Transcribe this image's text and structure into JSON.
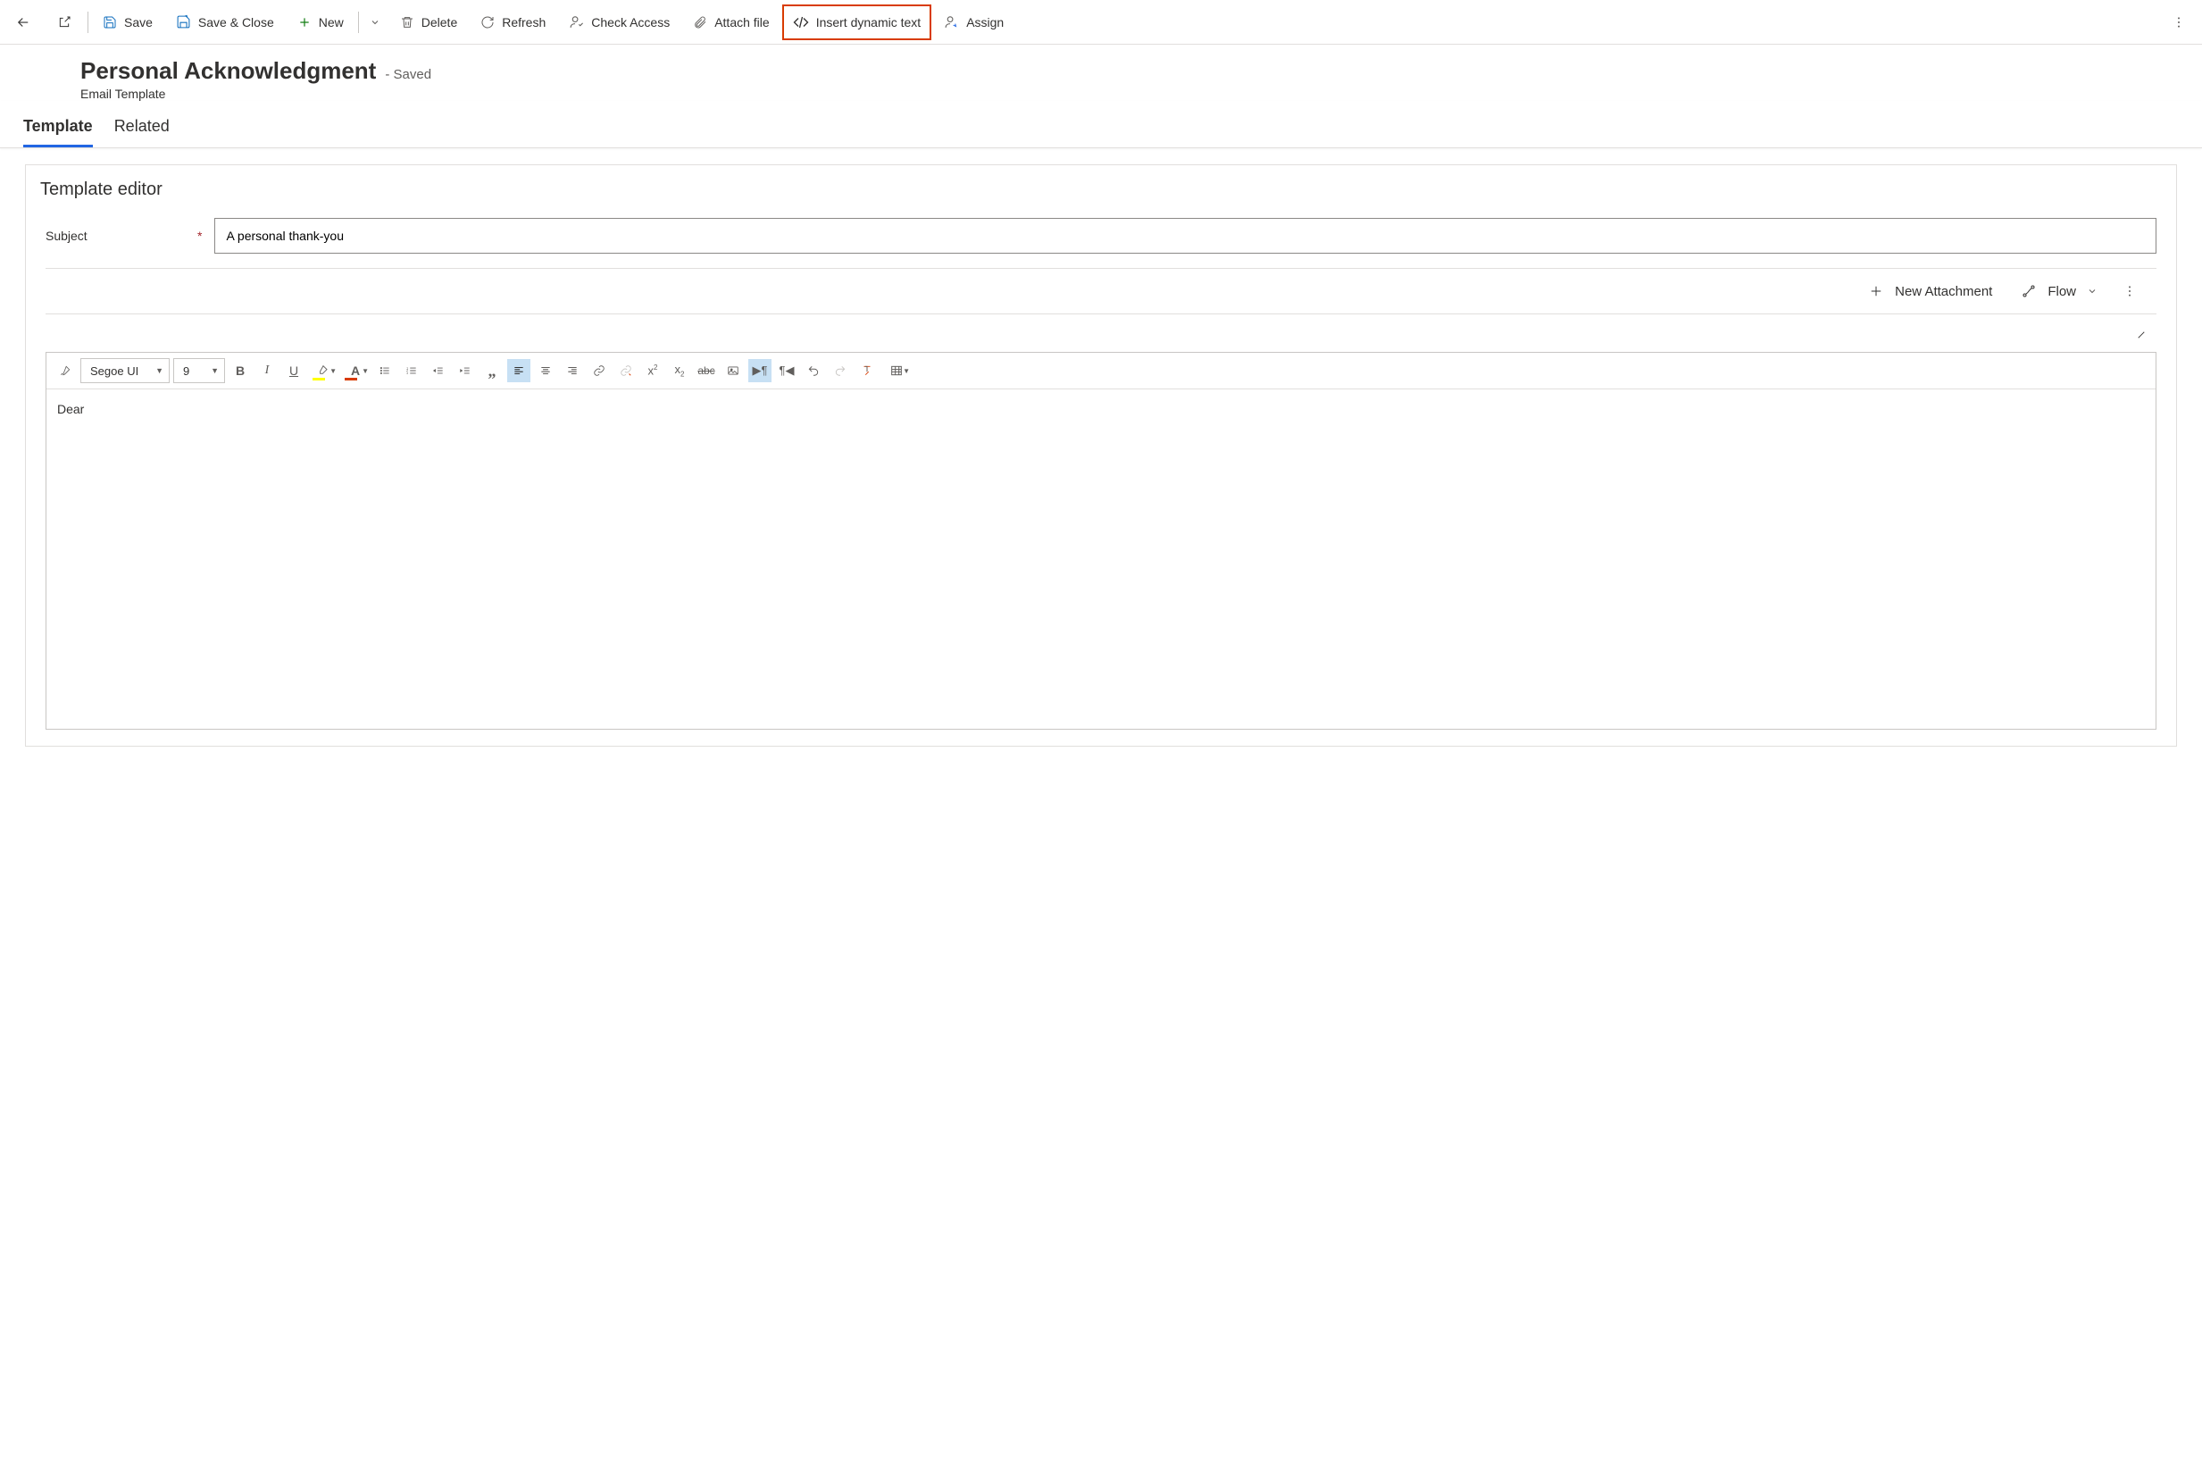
{
  "commandBar": {
    "save": "Save",
    "saveClose": "Save & Close",
    "new": "New",
    "delete": "Delete",
    "refresh": "Refresh",
    "checkAccess": "Check Access",
    "attachFile": "Attach file",
    "insertDynamic": "Insert dynamic text",
    "assign": "Assign"
  },
  "header": {
    "title": "Personal Acknowledgment",
    "status": "- Saved",
    "entity": "Email Template"
  },
  "tabs": {
    "template": "Template",
    "related": "Related"
  },
  "editor": {
    "panelTitle": "Template editor",
    "subjectLabel": "Subject",
    "subjectValue": "A personal thank-you",
    "newAttachment": "New Attachment",
    "flow": "Flow",
    "font": "Segoe UI",
    "fontSize": "9",
    "bodyText": "Dear"
  }
}
